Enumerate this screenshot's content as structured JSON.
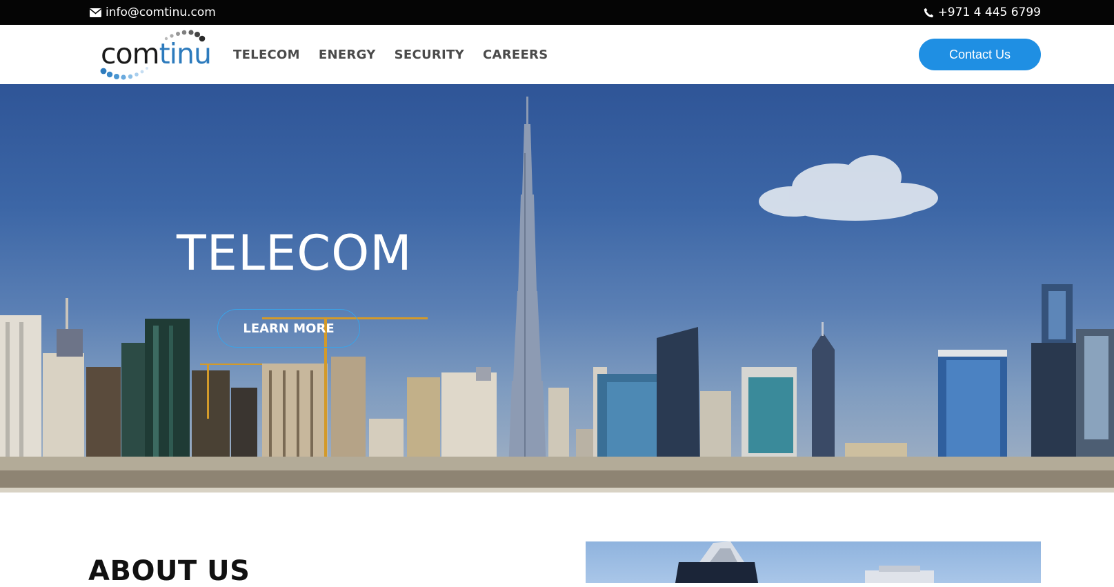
{
  "topbar": {
    "email": "info@comtinu.com",
    "email_icon": "envelope-icon",
    "phone": "+971 4 445 6799",
    "phone_icon": "phone-icon"
  },
  "header": {
    "logo_text_dark": "com",
    "logo_text_blue": "tinu",
    "nav": [
      "TELECOM",
      "ENERGY",
      "SECURITY",
      "CAREERS"
    ],
    "contact_label": "Contact Us",
    "accent_color": "#1f8fe3"
  },
  "hero": {
    "title": "TELECOM",
    "button_label": "LEARN MORE"
  },
  "about": {
    "title": "ABOUT US"
  }
}
